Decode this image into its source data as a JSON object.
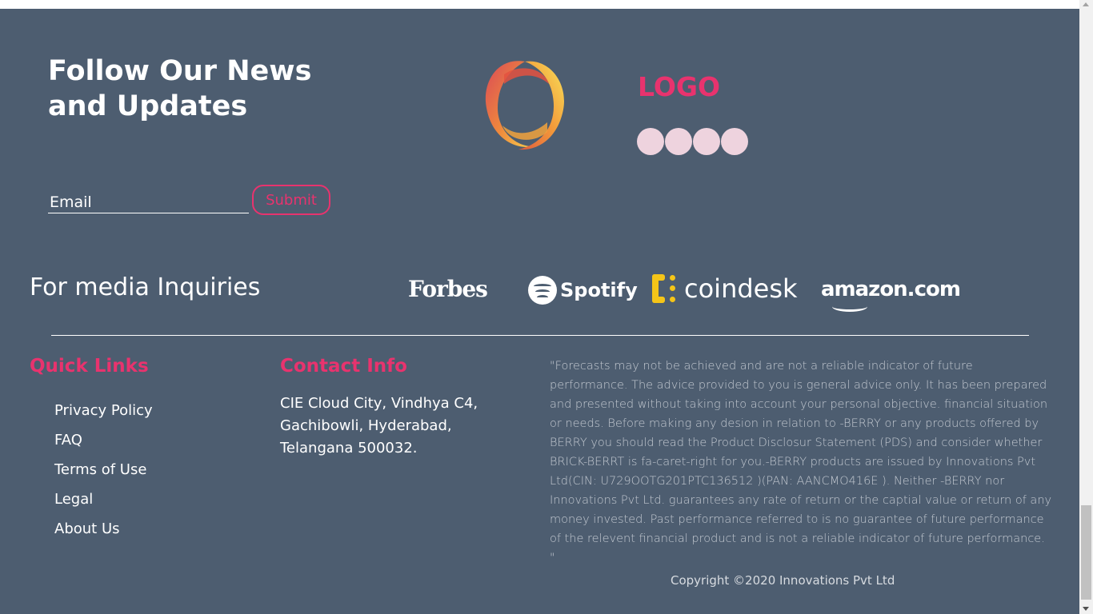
{
  "newsletter": {
    "title": "Follow Our News and Updates",
    "email_placeholder": "Email",
    "submit_label": "Submit"
  },
  "brand": {
    "logo_text": "LOGO",
    "social_count": 4,
    "colors": {
      "accent": "#e8336e",
      "background": "#4d5d70",
      "social_dot": "#eed3de"
    }
  },
  "media": {
    "title": "For media Inquiries",
    "partners": [
      "Forbes",
      "Spotify",
      "coindesk",
      "amazon.com"
    ]
  },
  "quick_links": {
    "heading": "Quick Links",
    "items": [
      "Privacy Policy",
      "FAQ",
      "Terms of Use",
      "Legal",
      "About Us"
    ]
  },
  "contact": {
    "heading": "Contact Info",
    "address": "CIE Cloud City, Vindhya C4, Gachibowli, Hyderabad, Telangana 500032."
  },
  "disclaimer": "\"Forecasts may not be achieved and are not a reliable indicator of future performance. The advice provided to you is general advice only. It has been prepared and presented without taking into account your personal objective. financial situation or needs. Before making any desion in relation to -BERRY or any products offered by BERRY you should read the Product Disclosur Statement (PDS) and consider whether BRICK-BERRT is fa-caret-right for you.-BERRY products are issued by Innovations Pvt Ltd(CIN: U729OOTG201PTC136512 )(PAN: AANCMO416E ). Neither -BERRY nor Innovations Pvt Ltd. guarantees any rate of return or the captial value or return of any money invested. Past performance referred to is no guarantee of future performance of the relevent financial product and is not a reliable indicator of future performance. \"",
  "copyright": "Copyright ©2020 Innovations Pvt Ltd"
}
